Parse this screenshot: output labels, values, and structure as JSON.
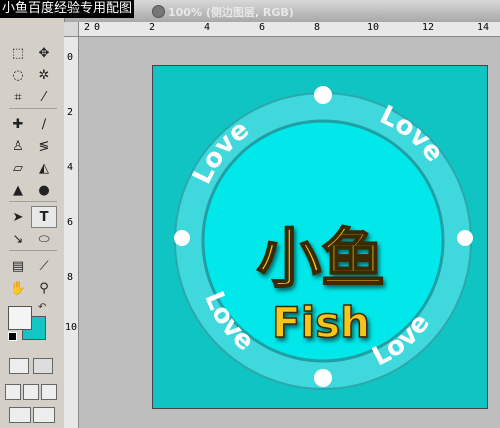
{
  "watermark": "小鱼百度经验专用配图",
  "window": {
    "title": "100% (侧边图层, RGB)"
  },
  "ruler": {
    "h_labels": [
      "2",
      "0",
      "2",
      "4",
      "6",
      "8",
      "10",
      "12",
      "14"
    ],
    "v_labels": [
      "0",
      "2",
      "4",
      "6",
      "8",
      "10"
    ]
  },
  "artwork": {
    "title_cn": "小鱼",
    "title_en": "Fish",
    "ring_word": "Love",
    "colors": {
      "canvas": "#11c4c4",
      "ring": "#3fd8dc",
      "inner": "#00e8ea",
      "text": "#f5c51f"
    }
  },
  "swatch": {
    "foreground": "#f4f4f4",
    "background": "#13c6c6"
  },
  "tools": [
    "marquee-icon",
    "move-icon",
    "lasso-icon",
    "magic-wand-icon",
    "crop-icon",
    "slice-icon",
    "healing-icon",
    "brush-icon",
    "stamp-icon",
    "history-brush-icon",
    "eraser-icon",
    "bucket-icon",
    "blur-icon",
    "dodge-icon",
    "path-select-icon",
    "type-icon",
    "pen-icon",
    "shape-icon",
    "notes-icon",
    "eyedropper-icon",
    "hand-icon",
    "zoom-icon"
  ]
}
